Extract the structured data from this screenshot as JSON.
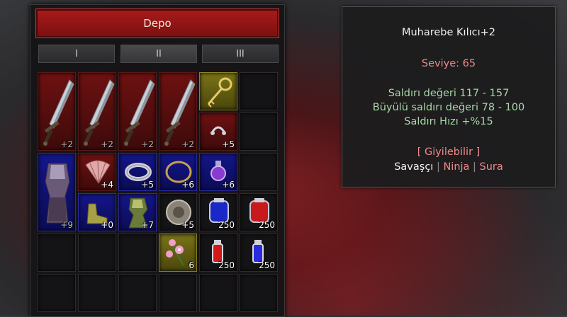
{
  "storage": {
    "title": "Depo",
    "tabs": [
      {
        "label": "I",
        "active": false
      },
      {
        "label": "II",
        "active": true
      },
      {
        "label": "III",
        "active": false
      }
    ],
    "items": [
      {
        "type": "sword",
        "qty": "+2"
      },
      {
        "type": "sword",
        "qty": "+2"
      },
      {
        "type": "sword",
        "qty": "+2"
      },
      {
        "type": "sword",
        "qty": "+2"
      },
      {
        "type": "key",
        "qty": ""
      },
      {
        "type": "earring",
        "qty": "+5"
      },
      {
        "type": "armor",
        "qty": "+9"
      },
      {
        "type": "fan",
        "qty": "+4"
      },
      {
        "type": "bracelet",
        "qty": "+5"
      },
      {
        "type": "necklace",
        "qty": "+6"
      },
      {
        "type": "potion-purple",
        "qty": "+6"
      },
      {
        "type": "shoes",
        "qty": "+0"
      },
      {
        "type": "armor-green",
        "qty": "+7"
      },
      {
        "type": "shield",
        "qty": "+5"
      },
      {
        "type": "potion-blue-big",
        "qty": "250"
      },
      {
        "type": "potion-red-big",
        "qty": "250"
      },
      {
        "type": "flower",
        "qty": "6"
      },
      {
        "type": "potion-red-small",
        "qty": "250"
      },
      {
        "type": "potion-blue-small",
        "qty": "250"
      }
    ]
  },
  "tooltip": {
    "name": "Muharebe Kılıcı+2",
    "level": "Seviye: 65",
    "attack": "Saldırı değeri 117 - 157",
    "magic_attack": "Büyülü saldırı değeri 78 - 100",
    "speed": "Saldırı Hızı +%15",
    "wearable": "[ Giyilebilir ]",
    "class_warrior": "Savaşçı",
    "class_ninja": "Ninja",
    "class_sura": "Sura",
    "separator": "|"
  }
}
